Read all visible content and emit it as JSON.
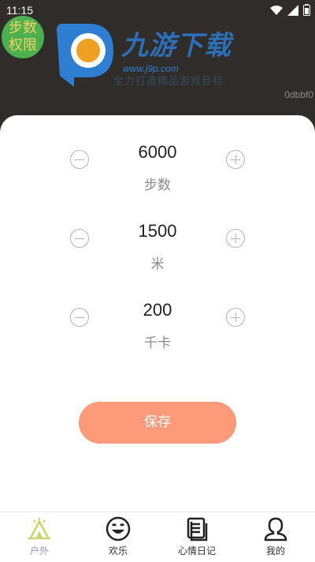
{
  "status_bar": {
    "time": "11:15"
  },
  "header": {
    "step_permission_line1": "步数",
    "step_permission_line2": "权限",
    "logo_name": "九游下载",
    "logo_url": "www.j9p.com",
    "logo_sub": "全力打造精品游戏目标",
    "hex_label": "0dbbf0"
  },
  "steppers": [
    {
      "value": "6000",
      "unit": "步数"
    },
    {
      "value": "1500",
      "unit": "米"
    },
    {
      "value": "200",
      "unit": "千卡"
    }
  ],
  "save_label": "保存",
  "tabs": [
    {
      "label": "户外",
      "icon": "tent-icon",
      "active": true
    },
    {
      "label": "欢乐",
      "icon": "smile-icon",
      "active": false
    },
    {
      "label": "心情日记",
      "icon": "notebook-icon",
      "active": false
    },
    {
      "label": "我的",
      "icon": "person-icon",
      "active": false
    }
  ],
  "colors": {
    "background": "#2f2c2a",
    "accent": "#fd9a7a",
    "active_tab": "#9b8fce",
    "step_badge": "#4caf50"
  }
}
